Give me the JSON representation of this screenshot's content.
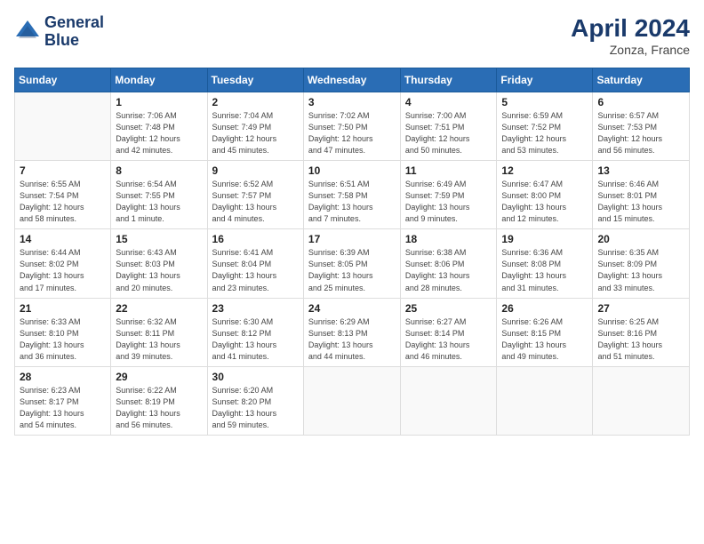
{
  "header": {
    "logo_line1": "General",
    "logo_line2": "Blue",
    "month": "April 2024",
    "location": "Zonza, France"
  },
  "weekdays": [
    "Sunday",
    "Monday",
    "Tuesday",
    "Wednesday",
    "Thursday",
    "Friday",
    "Saturday"
  ],
  "weeks": [
    [
      {
        "day": "",
        "info": ""
      },
      {
        "day": "1",
        "info": "Sunrise: 7:06 AM\nSunset: 7:48 PM\nDaylight: 12 hours\nand 42 minutes."
      },
      {
        "day": "2",
        "info": "Sunrise: 7:04 AM\nSunset: 7:49 PM\nDaylight: 12 hours\nand 45 minutes."
      },
      {
        "day": "3",
        "info": "Sunrise: 7:02 AM\nSunset: 7:50 PM\nDaylight: 12 hours\nand 47 minutes."
      },
      {
        "day": "4",
        "info": "Sunrise: 7:00 AM\nSunset: 7:51 PM\nDaylight: 12 hours\nand 50 minutes."
      },
      {
        "day": "5",
        "info": "Sunrise: 6:59 AM\nSunset: 7:52 PM\nDaylight: 12 hours\nand 53 minutes."
      },
      {
        "day": "6",
        "info": "Sunrise: 6:57 AM\nSunset: 7:53 PM\nDaylight: 12 hours\nand 56 minutes."
      }
    ],
    [
      {
        "day": "7",
        "info": "Sunrise: 6:55 AM\nSunset: 7:54 PM\nDaylight: 12 hours\nand 58 minutes."
      },
      {
        "day": "8",
        "info": "Sunrise: 6:54 AM\nSunset: 7:55 PM\nDaylight: 13 hours\nand 1 minute."
      },
      {
        "day": "9",
        "info": "Sunrise: 6:52 AM\nSunset: 7:57 PM\nDaylight: 13 hours\nand 4 minutes."
      },
      {
        "day": "10",
        "info": "Sunrise: 6:51 AM\nSunset: 7:58 PM\nDaylight: 13 hours\nand 7 minutes."
      },
      {
        "day": "11",
        "info": "Sunrise: 6:49 AM\nSunset: 7:59 PM\nDaylight: 13 hours\nand 9 minutes."
      },
      {
        "day": "12",
        "info": "Sunrise: 6:47 AM\nSunset: 8:00 PM\nDaylight: 13 hours\nand 12 minutes."
      },
      {
        "day": "13",
        "info": "Sunrise: 6:46 AM\nSunset: 8:01 PM\nDaylight: 13 hours\nand 15 minutes."
      }
    ],
    [
      {
        "day": "14",
        "info": "Sunrise: 6:44 AM\nSunset: 8:02 PM\nDaylight: 13 hours\nand 17 minutes."
      },
      {
        "day": "15",
        "info": "Sunrise: 6:43 AM\nSunset: 8:03 PM\nDaylight: 13 hours\nand 20 minutes."
      },
      {
        "day": "16",
        "info": "Sunrise: 6:41 AM\nSunset: 8:04 PM\nDaylight: 13 hours\nand 23 minutes."
      },
      {
        "day": "17",
        "info": "Sunrise: 6:39 AM\nSunset: 8:05 PM\nDaylight: 13 hours\nand 25 minutes."
      },
      {
        "day": "18",
        "info": "Sunrise: 6:38 AM\nSunset: 8:06 PM\nDaylight: 13 hours\nand 28 minutes."
      },
      {
        "day": "19",
        "info": "Sunrise: 6:36 AM\nSunset: 8:08 PM\nDaylight: 13 hours\nand 31 minutes."
      },
      {
        "day": "20",
        "info": "Sunrise: 6:35 AM\nSunset: 8:09 PM\nDaylight: 13 hours\nand 33 minutes."
      }
    ],
    [
      {
        "day": "21",
        "info": "Sunrise: 6:33 AM\nSunset: 8:10 PM\nDaylight: 13 hours\nand 36 minutes."
      },
      {
        "day": "22",
        "info": "Sunrise: 6:32 AM\nSunset: 8:11 PM\nDaylight: 13 hours\nand 39 minutes."
      },
      {
        "day": "23",
        "info": "Sunrise: 6:30 AM\nSunset: 8:12 PM\nDaylight: 13 hours\nand 41 minutes."
      },
      {
        "day": "24",
        "info": "Sunrise: 6:29 AM\nSunset: 8:13 PM\nDaylight: 13 hours\nand 44 minutes."
      },
      {
        "day": "25",
        "info": "Sunrise: 6:27 AM\nSunset: 8:14 PM\nDaylight: 13 hours\nand 46 minutes."
      },
      {
        "day": "26",
        "info": "Sunrise: 6:26 AM\nSunset: 8:15 PM\nDaylight: 13 hours\nand 49 minutes."
      },
      {
        "day": "27",
        "info": "Sunrise: 6:25 AM\nSunset: 8:16 PM\nDaylight: 13 hours\nand 51 minutes."
      }
    ],
    [
      {
        "day": "28",
        "info": "Sunrise: 6:23 AM\nSunset: 8:17 PM\nDaylight: 13 hours\nand 54 minutes."
      },
      {
        "day": "29",
        "info": "Sunrise: 6:22 AM\nSunset: 8:19 PM\nDaylight: 13 hours\nand 56 minutes."
      },
      {
        "day": "30",
        "info": "Sunrise: 6:20 AM\nSunset: 8:20 PM\nDaylight: 13 hours\nand 59 minutes."
      },
      {
        "day": "",
        "info": ""
      },
      {
        "day": "",
        "info": ""
      },
      {
        "day": "",
        "info": ""
      },
      {
        "day": "",
        "info": ""
      }
    ]
  ]
}
